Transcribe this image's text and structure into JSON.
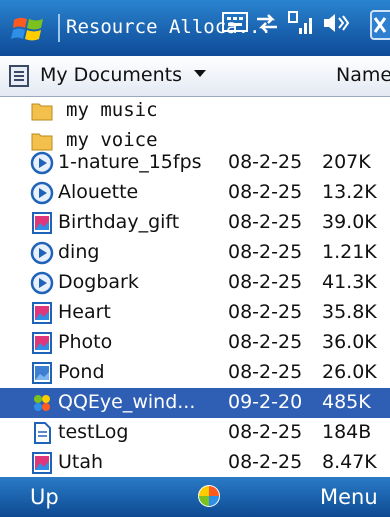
{
  "titlebar": {
    "title": "Resource Alloca...",
    "start_icon": "windows-flag-icon",
    "status_icons": [
      "keyboard-icon",
      "sync-arrows-icon",
      "signal-strength-icon",
      "speaker-icon",
      "close-icon"
    ]
  },
  "pathbar": {
    "folder": "My Documents",
    "sort": "Name"
  },
  "folders": [
    {
      "name": "my music"
    },
    {
      "name": "my voice"
    }
  ],
  "files": [
    {
      "name": "1-nature_15fps",
      "date": "08-2-25",
      "size": "207K",
      "icon": "media-icon"
    },
    {
      "name": "Alouette",
      "date": "08-2-25",
      "size": "13.2K",
      "icon": "media-icon"
    },
    {
      "name": "Birthday_gift",
      "date": "08-2-25",
      "size": "39.0K",
      "icon": "picture-icon"
    },
    {
      "name": "ding",
      "date": "08-2-25",
      "size": "1.21K",
      "icon": "media-icon"
    },
    {
      "name": "Dogbark",
      "date": "08-2-25",
      "size": "41.3K",
      "icon": "media-icon"
    },
    {
      "name": "Heart",
      "date": "08-2-25",
      "size": "35.8K",
      "icon": "picture-icon"
    },
    {
      "name": "Photo",
      "date": "08-2-25",
      "size": "36.0K",
      "icon": "picture-icon"
    },
    {
      "name": "Pond",
      "date": "08-2-25",
      "size": "26.0K",
      "icon": "picture-icon"
    },
    {
      "name": "QQEye_wind...",
      "date": "09-2-20",
      "size": "485K",
      "icon": "executable-icon",
      "selected": true
    },
    {
      "name": "testLog",
      "date": "08-2-25",
      "size": "184B",
      "icon": "document-icon"
    },
    {
      "name": "Utah",
      "date": "08-2-25",
      "size": "8.47K",
      "icon": "picture-icon"
    }
  ],
  "softkeys": {
    "left": "Up",
    "right": "Menu",
    "center_icon": "windows-logo-icon"
  },
  "colors": {
    "titlebar": "#1a63b0",
    "selection": "#2f5fb4"
  }
}
